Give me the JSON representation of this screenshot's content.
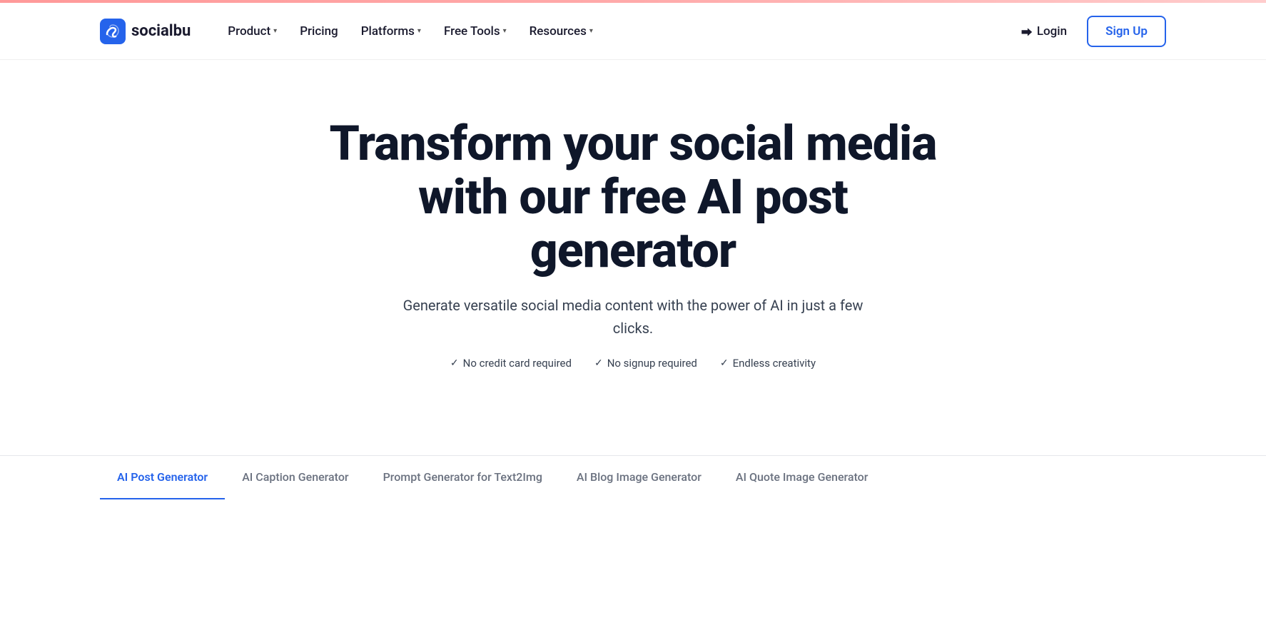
{
  "topBar": {
    "show": true
  },
  "navbar": {
    "logo": {
      "text": "socialbu",
      "icon_name": "socialbu-logo-icon"
    },
    "menu": [
      {
        "label": "Product",
        "hasDropdown": true,
        "id": "product"
      },
      {
        "label": "Pricing",
        "hasDropdown": false,
        "id": "pricing"
      },
      {
        "label": "Platforms",
        "hasDropdown": true,
        "id": "platforms"
      },
      {
        "label": "Free Tools",
        "hasDropdown": true,
        "id": "free-tools"
      },
      {
        "label": "Resources",
        "hasDropdown": true,
        "id": "resources"
      }
    ],
    "login": {
      "label": "Login",
      "icon": "login-icon"
    },
    "signup": {
      "label": "Sign Up"
    }
  },
  "hero": {
    "title": "Transform your social media with our free AI post generator",
    "subtitle": "Generate versatile social media content with the power of AI in just a few clicks.",
    "badges": [
      {
        "text": "No credit card required"
      },
      {
        "text": "No signup required"
      },
      {
        "text": "Endless creativity"
      }
    ]
  },
  "tabs": [
    {
      "label": "AI Post Generator",
      "active": true,
      "id": "ai-post-generator"
    },
    {
      "label": "AI Caption Generator",
      "active": false,
      "id": "ai-caption-generator"
    },
    {
      "label": "Prompt Generator for Text2Img",
      "active": false,
      "id": "prompt-generator"
    },
    {
      "label": "AI Blog Image Generator",
      "active": false,
      "id": "ai-blog-image-generator"
    },
    {
      "label": "AI Quote Image Generator",
      "active": false,
      "id": "ai-quote-image-generator"
    }
  ]
}
